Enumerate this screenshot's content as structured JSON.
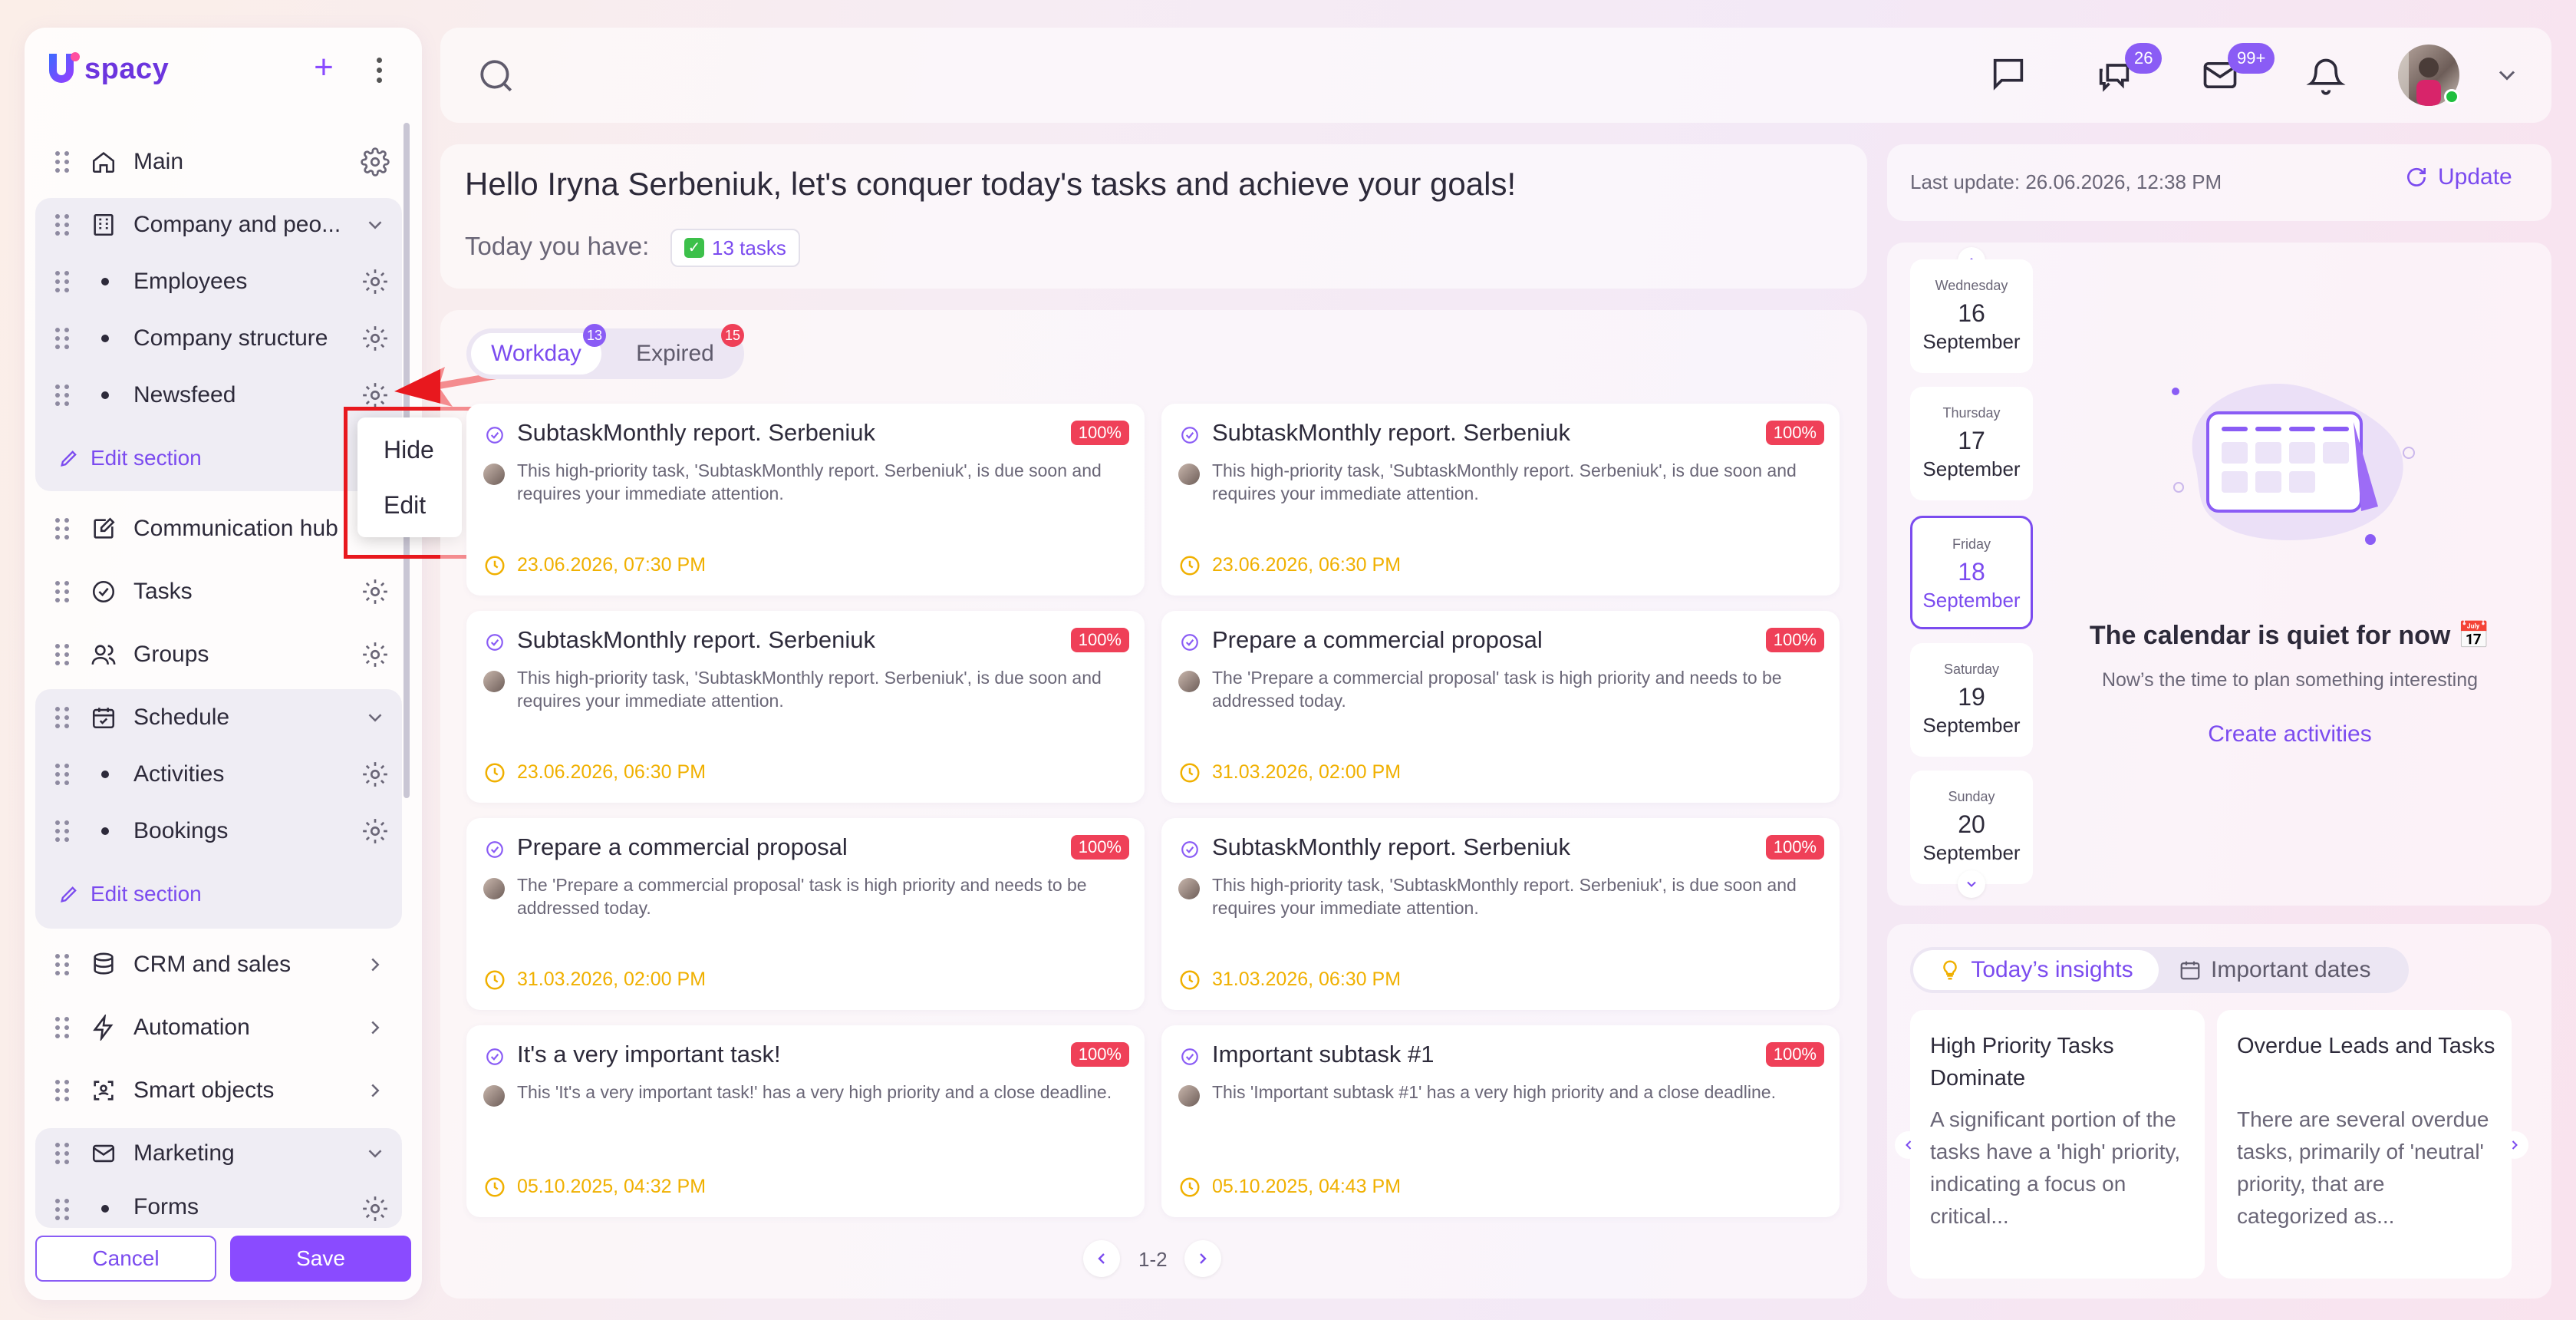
{
  "app": {
    "logo_text": "spacy"
  },
  "sidebar": {
    "items": [
      {
        "label": "Main"
      },
      {
        "label": "Company and peo..."
      },
      {
        "label": "Employees"
      },
      {
        "label": "Company structure"
      },
      {
        "label": "Newsfeed"
      },
      {
        "label": "Communication hub"
      },
      {
        "label": "Tasks"
      },
      {
        "label": "Groups"
      },
      {
        "label": "Schedule"
      },
      {
        "label": "Activities"
      },
      {
        "label": "Bookings"
      },
      {
        "label": "CRM and sales"
      },
      {
        "label": "Automation"
      },
      {
        "label": "Smart objects"
      },
      {
        "label": "Marketing"
      },
      {
        "label": "Forms"
      }
    ],
    "edit_section": "Edit section",
    "cancel": "Cancel",
    "save": "Save"
  },
  "context_menu": {
    "hide": "Hide",
    "edit": "Edit"
  },
  "topbar": {
    "chat_badge": "26",
    "mail_badge": "99+"
  },
  "greeting": {
    "title": "Hello Iryna Serbeniuk, let's conquer today's tasks and achieve your goals!",
    "today_label": "Today you have:",
    "tasks_chip": "13 tasks"
  },
  "tasks": {
    "tabs": [
      {
        "label": "Workday",
        "badge": "13"
      },
      {
        "label": "Expired",
        "badge": "15"
      }
    ],
    "cards": [
      {
        "title": "SubtaskMonthly report. Serbeniuk",
        "pct": "100%",
        "desc": "This high-priority task, 'SubtaskMonthly report. Serbeniuk', is due soon and requires your immediate attention.",
        "date": "23.06.2026, 07:30 PM"
      },
      {
        "title": "SubtaskMonthly report. Serbeniuk",
        "pct": "100%",
        "desc": "This high-priority task, 'SubtaskMonthly report. Serbeniuk', is due soon and requires your immediate attention.",
        "date": "23.06.2026, 06:30 PM"
      },
      {
        "title": "SubtaskMonthly report. Serbeniuk",
        "pct": "100%",
        "desc": "This high-priority task, 'SubtaskMonthly report. Serbeniuk', is due soon and requires your immediate attention.",
        "date": "23.06.2026, 06:30 PM"
      },
      {
        "title": "Prepare a commercial proposal",
        "pct": "100%",
        "desc": "The 'Prepare a commercial proposal' task is high priority and needs to be addressed today.",
        "date": "31.03.2026, 02:00 PM"
      },
      {
        "title": "Prepare a commercial proposal",
        "pct": "100%",
        "desc": "The 'Prepare a commercial proposal' task is high priority and needs to be addressed today.",
        "date": "31.03.2026, 02:00 PM"
      },
      {
        "title": "SubtaskMonthly report. Serbeniuk",
        "pct": "100%",
        "desc": "This high-priority task, 'SubtaskMonthly report. Serbeniuk', is due soon and requires your immediate attention.",
        "date": "31.03.2026, 06:30 PM"
      },
      {
        "title": "It's a very important task!",
        "pct": "100%",
        "desc": "This 'It's a very important task!' has a very high priority and a close deadline.",
        "date": "05.10.2025, 04:32 PM"
      },
      {
        "title": "Important subtask #1",
        "pct": "100%",
        "desc": "This 'Important subtask #1' has a very high priority and a close deadline.",
        "date": "05.10.2025, 04:43 PM"
      }
    ],
    "pagination": "1-2"
  },
  "update": {
    "last_update": "Last update: 26.06.2026, 12:38 PM",
    "button": "Update"
  },
  "calendar": {
    "days": [
      {
        "name": "Wednesday",
        "num": "16",
        "month": "September"
      },
      {
        "name": "Thursday",
        "num": "17",
        "month": "September"
      },
      {
        "name": "Friday",
        "num": "18",
        "month": "September"
      },
      {
        "name": "Saturday",
        "num": "19",
        "month": "September"
      },
      {
        "name": "Sunday",
        "num": "20",
        "month": "September"
      }
    ],
    "empty_title": "The calendar is quiet for now 📅",
    "empty_sub": "Now’s the time to plan something interesting",
    "create": "Create activities"
  },
  "insights": {
    "tabs": [
      "Today’s insights",
      "Important dates"
    ],
    "cards": [
      {
        "title": "High Priority Tasks Dominate",
        "body": "A significant portion of the tasks have a 'high' priority, indicating a focus on critical..."
      },
      {
        "title": "Overdue Leads and Tasks",
        "body": "There are several overdue tasks, primarily of 'neutral' priority, that are categorized as..."
      }
    ]
  },
  "colors": {
    "accent": "#8a4bff",
    "danger": "#ef4058",
    "warning": "#f0b000",
    "success": "#1fbf3e"
  }
}
